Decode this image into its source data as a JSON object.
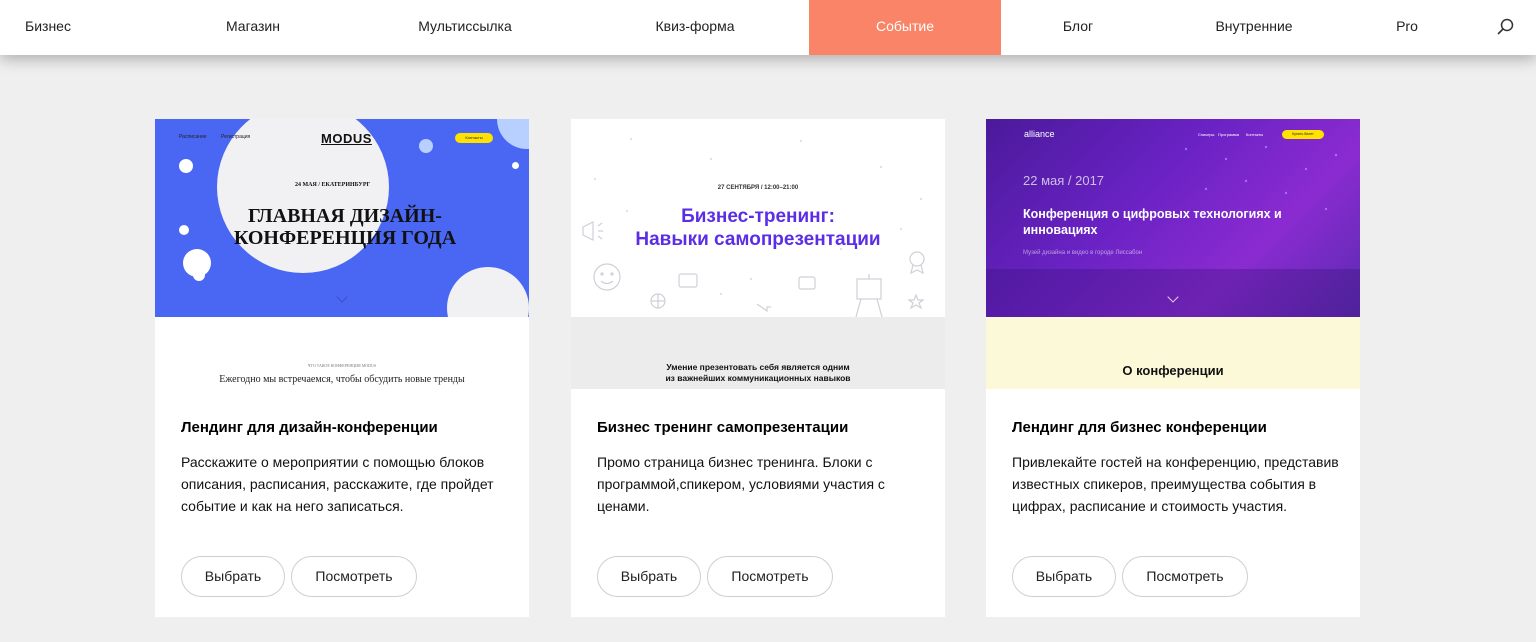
{
  "nav": {
    "items": [
      {
        "label": "Бизнес",
        "active": false
      },
      {
        "label": "Магазин",
        "active": false
      },
      {
        "label": "Мультиссылка",
        "active": false
      },
      {
        "label": "Квиз-форма",
        "active": false
      },
      {
        "label": "Событие",
        "active": true
      },
      {
        "label": "Блог",
        "active": false
      },
      {
        "label": "Внутренние",
        "active": false
      },
      {
        "label": "Pro",
        "active": false
      }
    ],
    "search_icon": "search-icon",
    "active_color": "#f98468"
  },
  "cards": [
    {
      "title": "Лендинг для дизайн-конференции",
      "description": "Расскажите о мероприятии с помощью блоков описания, расписания, расскажите, где пройдет событие и как на него записаться.",
      "select_label": "Выбрать",
      "view_label": "Посмотреть",
      "preview": {
        "nav_left": "Расписание",
        "nav_left2": "Регистрация",
        "logo": "MODUS",
        "button": "Контакты",
        "date": "24 МАЯ / ЕКАТЕРИНБУРГ",
        "headline": "ГЛАВНАЯ ДИЗАЙН-КОНФЕРЕНЦИЯ ГОДА",
        "small_caption": "ЧТО ТАКОЕ КОНФЕРЕНЦИЯ MODUS",
        "subtext": "Ежегодно мы встречаемся, чтобы обсудить новые тренды",
        "accent": "#4a67f3"
      }
    },
    {
      "title": "Бизнес тренинг самопрезентации",
      "description": "Промо страница бизнес тренинга. Блоки с программой,спикером, условиями участия с ценами.",
      "select_label": "Выбрать",
      "view_label": "Посмотреть",
      "preview": {
        "date": "27 СЕНТЯБРЯ / 12:00–21:00",
        "headline_line1": "Бизнес-тренинг:",
        "headline_line2": "Навыки самопрезентации",
        "subtext_line1": "Умение презентовать себя является одним",
        "subtext_line2": "из важнейших коммуникационных навыков",
        "accent": "#5b2ee6"
      }
    },
    {
      "title": "Лендинг для бизнес конференции",
      "description": "Привлекайте гостей на конференцию, представив известных спикеров, преимущества события в цифрах, расписание и стоимость участия.",
      "select_label": "Выбрать",
      "view_label": "Посмотреть",
      "preview": {
        "logo": "alliance",
        "nav1": "Спикеры",
        "nav2": "Программа",
        "nav3": "Контакты",
        "button": "Купить билет",
        "date": "22 мая / 2017",
        "headline": "Конференция о цифровых технологиях и инновациях",
        "subtext": "Музей дизайна и видео в городе Лиссабон",
        "about": "О конференции",
        "accent": "#6a22c4"
      }
    }
  ]
}
